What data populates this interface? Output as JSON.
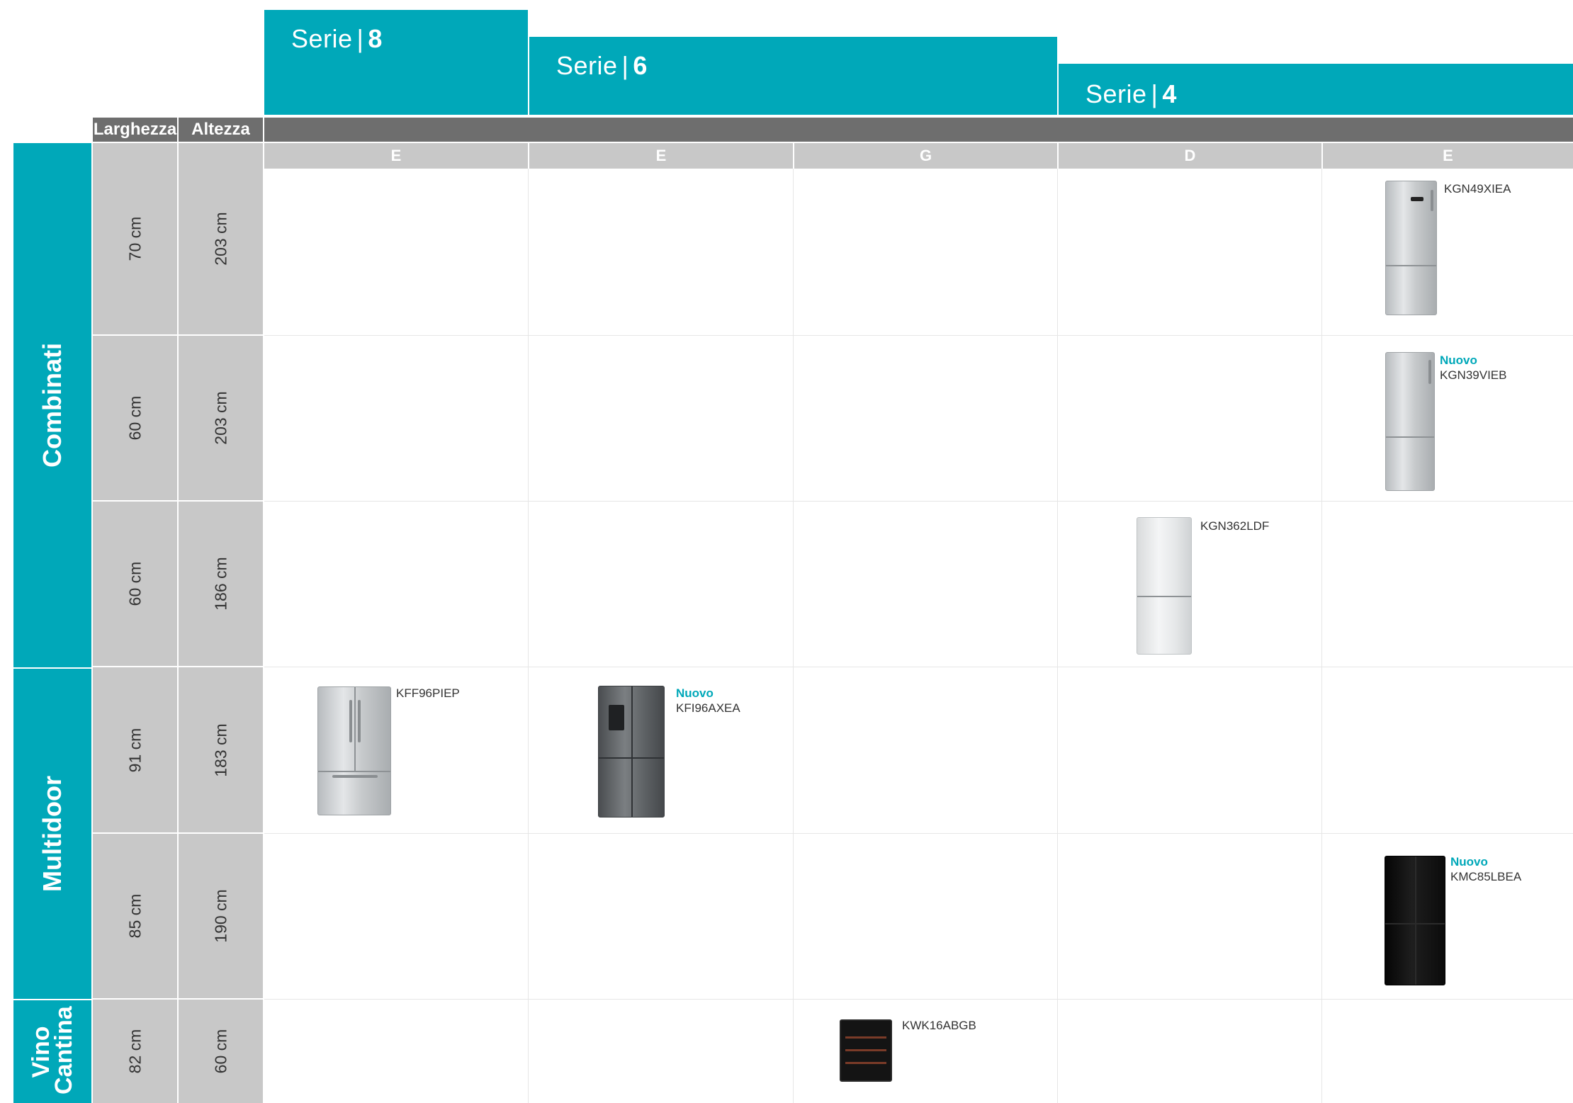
{
  "series": [
    {
      "label": "Serie",
      "sep": "|",
      "number": "8"
    },
    {
      "label": "Serie",
      "sep": "|",
      "number": "6"
    },
    {
      "label": "Serie",
      "sep": "|",
      "number": "4"
    }
  ],
  "dim_headers": {
    "width": "Larghezza",
    "height": "Altezza"
  },
  "energy_classes": [
    "E",
    "E",
    "G",
    "D",
    "E"
  ],
  "categories": [
    "Combinati",
    "Multidoor",
    "Vino Cantina"
  ],
  "rows": [
    {
      "width": "70 cm",
      "height": "203 cm"
    },
    {
      "width": "60 cm",
      "height": "203 cm"
    },
    {
      "width": "60 cm",
      "height": "186 cm"
    },
    {
      "width": "91 cm",
      "height": "183 cm"
    },
    {
      "width": "85 cm",
      "height": "190 cm"
    },
    {
      "width": "82 cm",
      "height": "60 cm"
    }
  ],
  "products": {
    "kgn49xiea": {
      "model": "KGN49XIEA",
      "badge": ""
    },
    "kgn39vieb": {
      "model": "KGN39VIEB",
      "badge": "Nuovo"
    },
    "kgn362ldf": {
      "model": "KGN362LDF",
      "badge": ""
    },
    "kff96piep": {
      "model": "KFF96PIEP",
      "badge": ""
    },
    "kfi96axea": {
      "model": "KFI96AXEA",
      "badge": "Nuovo"
    },
    "kmc85lbea": {
      "model": "KMC85LBEA",
      "badge": "Nuovo"
    },
    "kwk16abgb": {
      "model": "KWK16ABGB",
      "badge": ""
    }
  },
  "colors": {
    "accent": "#00a8b9",
    "header_dark": "#6e6e6e",
    "header_light": "#c8c8c8"
  }
}
